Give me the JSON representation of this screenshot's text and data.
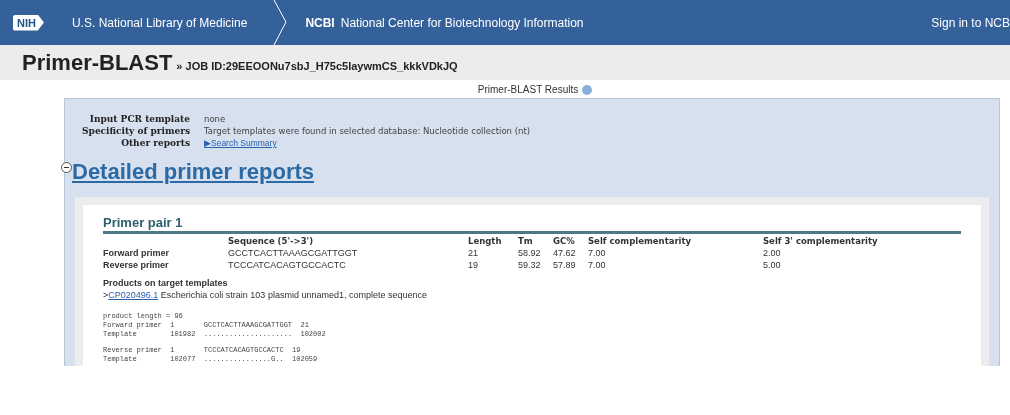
{
  "header": {
    "logo": "NIH",
    "library": "U.S. National Library of Medicine",
    "ncbi_abbr": "NCBI",
    "ncbi_name": "National Center for Biotechnology Information",
    "sign_in": "Sign in to NCB"
  },
  "title": {
    "app": "Primer-BLAST",
    "job": "» JOB ID:29EEOONu7sbJ_H75c5laywmCS_kkkVDkJQ"
  },
  "results_title": "Primer-BLAST Results",
  "summary": [
    {
      "label": "Input PCR template",
      "value": "none",
      "kind": "text"
    },
    {
      "label": "Specificity of primers",
      "value": "Target templates were found in selected database: Nucleotide collection (nt)",
      "kind": "text"
    },
    {
      "label": "Other reports",
      "value": "▶Search Summary",
      "kind": "link"
    }
  ],
  "section": {
    "title": "Detailed primer reports",
    "expanded": true
  },
  "pair": {
    "title": "Primer pair 1",
    "columns": [
      "",
      "Sequence (5'->3')",
      "Length",
      "Tm",
      "GC%",
      "Self complementarity",
      "Self 3' complementarity"
    ],
    "rows": [
      [
        "Forward primer",
        "GCCTCACTTAAAGCGATTGGT",
        "21",
        "58.92",
        "47.62",
        "7.00",
        "2.00"
      ],
      [
        "Reverse primer",
        "TCCCATCACAGTGCCACTC",
        "19",
        "59.32",
        "57.89",
        "7.00",
        "5.00"
      ]
    ],
    "products_title": "Products on target templates",
    "product_prefix": ">",
    "accession": "CP020496.1",
    "description": "Escherichia coli strain 103 plasmid unnamed1, complete sequence",
    "alignments": [
      [
        "product length = 96",
        "Forward primer  1       GCCTCACTTAAAGCGATTGGT  21",
        "Template        101982  .....................  102002"
      ],
      [
        "Reverse primer  1       TCCCATCACAGTGCCACTC  19",
        "Template        102077  ................G..  102059"
      ]
    ]
  }
}
